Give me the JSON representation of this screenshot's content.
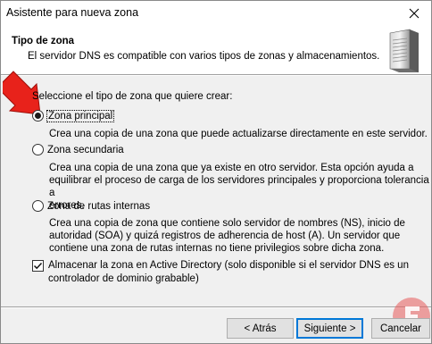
{
  "window": {
    "title": "Asistente para nueva zona"
  },
  "header": {
    "title": "Tipo de zona",
    "subtitle": "El servidor DNS es compatible con varios tipos de zonas y almacenamientos.",
    "icon": "server-icon"
  },
  "prompt": "Seleccione el tipo de zona que quiere crear:",
  "options": [
    {
      "label": "Zona principal",
      "checked": true,
      "description_lines": [
        "Crea una copia de una zona que puede actualizarse directamente en este servidor."
      ]
    },
    {
      "label": "Zona secundaria",
      "checked": false,
      "description_lines": [
        "Crea una copia de una zona que ya existe en otro servidor. Esta opción ayuda a",
        "equilibrar el proceso de carga de los servidores principales y proporciona tolerancia a",
        "errores."
      ]
    },
    {
      "label": "Zona de rutas internas",
      "checked": false,
      "description_lines": [
        "Crea una copia de zona que contiene solo servidor de nombres (NS), inicio de",
        "autoridad (SOA) y quizá registros de adherencia de host (A). Un servidor que",
        "contiene una zona de rutas internas no tiene privilegios sobre dicha zona."
      ]
    }
  ],
  "ad_option": {
    "checked": true,
    "label_lines": [
      "Almacenar la zona en Active Directory (solo disponible si el servidor DNS es un",
      "controlador de dominio grabable)"
    ]
  },
  "buttons": {
    "back": "< Atrás",
    "next": "Siguiente >",
    "cancel": "Cancelar"
  },
  "colors": {
    "arrow": "#e8221b",
    "primary_border": "#0078d7",
    "watermark": "#e85a5a"
  }
}
